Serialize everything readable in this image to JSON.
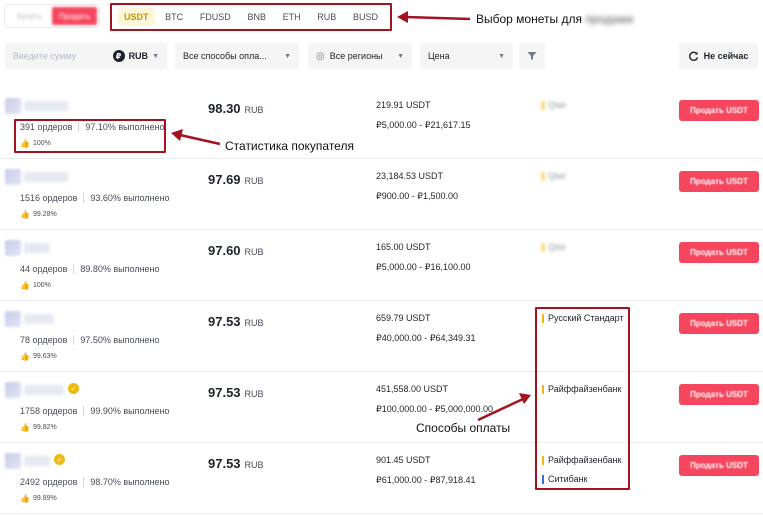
{
  "trade_toggle": {
    "buy": "Купить",
    "sell": "Продать"
  },
  "coin_tabs": [
    "USDT",
    "BTC",
    "FDUSD",
    "BNB",
    "ETH",
    "RUB",
    "BUSD"
  ],
  "annotations": {
    "coin_select": "Выбор монеты для",
    "coin_select_blurred": "продажи",
    "buyer_stats": "Статистика покупателя",
    "payment_methods": "Способы оплаты"
  },
  "filters": {
    "amount_placeholder": "Введите сумму",
    "currency": "RUB",
    "currency_icon": "₽",
    "payment": "Все способы опла...",
    "region": "Все регионы",
    "sort": "Цена",
    "not_now": "Не сейчас"
  },
  "colors": {
    "sell": "#f6465d",
    "accent": "#f0b90b",
    "annotation": "#a3131f",
    "positive": "#0ecb81"
  },
  "rows": [
    {
      "orders": "391 ордеров",
      "completion": "97.10% выполнено",
      "rating": "100%",
      "price": "98.30",
      "currency": "RUB",
      "available": "219.91 USDT",
      "limit": "₽5,000.00 - ₽21,617.15",
      "payments": [
        "Qiwi"
      ],
      "sell": "Продать USDT"
    },
    {
      "orders": "1516 ордеров",
      "completion": "93.60% выполнено",
      "rating": "99.28%",
      "price": "97.69",
      "currency": "RUB",
      "available": "23,184.53 USDT",
      "limit": "₽900.00 - ₽1,500.00",
      "payments": [
        "Qiwi"
      ],
      "sell": "Продать USDT"
    },
    {
      "orders": "44 ордеров",
      "completion": "89.80% выполнено",
      "rating": "100%",
      "price": "97.60",
      "currency": "RUB",
      "available": "165.00 USDT",
      "limit": "₽5,000.00 - ₽16,100.00",
      "payments": [
        "Qiwi"
      ],
      "sell": "Продать USDT"
    },
    {
      "orders": "78 ордеров",
      "completion": "97.50% выполнено",
      "rating": "99.63%",
      "price": "97.53",
      "currency": "RUB",
      "available": "659.79 USDT",
      "limit": "₽40,000.00 - ₽64,349.31",
      "payments": [
        "Русский Стандарт"
      ],
      "sell": "Продать USDT"
    },
    {
      "orders": "1758 ордеров",
      "completion": "99.90% выполнено",
      "rating": "99.82%",
      "price": "97.53",
      "currency": "RUB",
      "available": "451,558.00 USDT",
      "limit": "₽100,000.00 - ₽5,000,000.00",
      "payments": [
        "Райффайзенбанк"
      ],
      "sell": "Продать USDT"
    },
    {
      "orders": "2492 ордеров",
      "completion": "98.70% выполнено",
      "rating": "99.89%",
      "price": "97.53",
      "currency": "RUB",
      "available": "901.45 USDT",
      "limit": "₽61,000.00 - ₽87,918.41",
      "payments": [
        "Райффайзенбанк",
        "Ситибанк"
      ],
      "sell": "Продать USDT"
    }
  ]
}
